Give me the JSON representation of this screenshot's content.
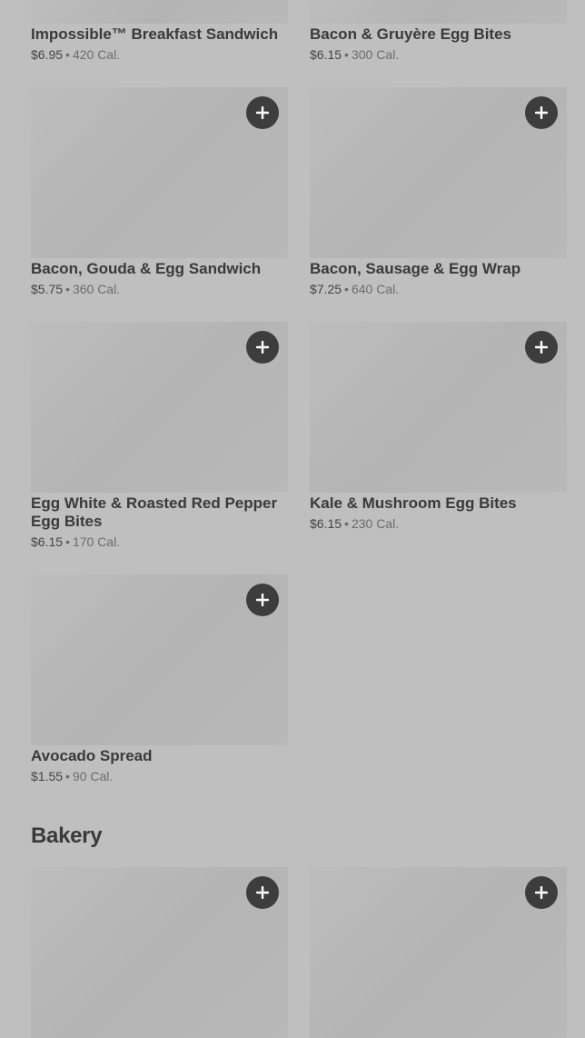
{
  "menu": {
    "items": [
      {
        "name": "Impossible™ Breakfast Sandwich",
        "price": "$6.95",
        "calories": "420 Cal."
      },
      {
        "name": "Bacon & Gruyère Egg Bites",
        "price": "$6.15",
        "calories": "300 Cal."
      },
      {
        "name": "Bacon, Gouda & Egg Sandwich",
        "price": "$5.75",
        "calories": "360 Cal."
      },
      {
        "name": "Bacon, Sausage & Egg Wrap",
        "price": "$7.25",
        "calories": "640 Cal."
      },
      {
        "name": "Egg White & Roasted Red Pepper Egg Bites",
        "price": "$6.15",
        "calories": "170 Cal."
      },
      {
        "name": "Kale & Mushroom Egg Bites",
        "price": "$6.15",
        "calories": "230 Cal."
      },
      {
        "name": "Avocado Spread",
        "price": "$1.55",
        "calories": "90 Cal."
      }
    ],
    "separator": "•"
  },
  "bakery": {
    "title": "Bakery"
  },
  "icons": {
    "add": "plus-icon"
  },
  "colors": {
    "background": "#bfbfbf",
    "button": "#3d3d3d",
    "text": "#3a3a3a"
  }
}
